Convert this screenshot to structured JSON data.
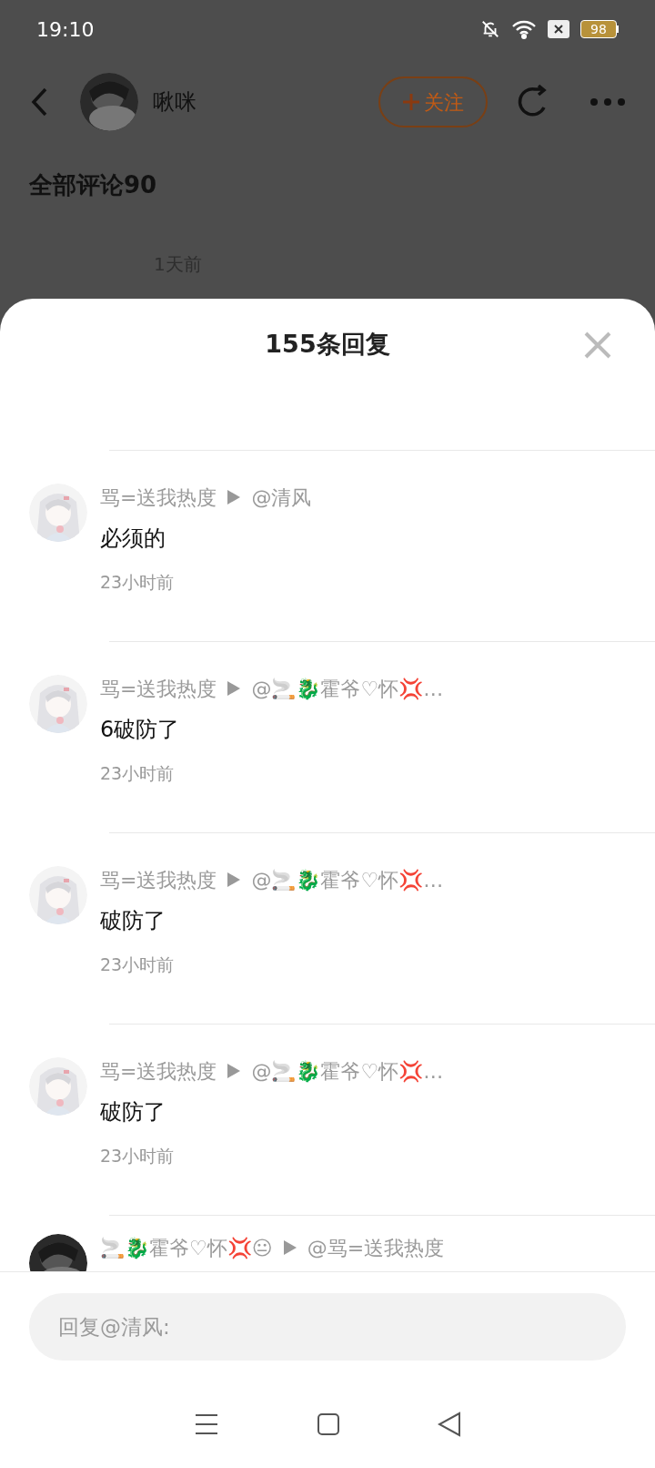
{
  "status_bar": {
    "time": "19:10",
    "battery": "98"
  },
  "header": {
    "username": "啾咪",
    "follow_button": "关注"
  },
  "background": {
    "section_title": "全部评论90",
    "comment_time": "1天前"
  },
  "replies_sheet": {
    "title": "155条回复",
    "replies": [
      {
        "author": "骂=送我热度",
        "reply_to": "@清风",
        "content": "必须的",
        "time": "23小时前"
      },
      {
        "author": "骂=送我热度",
        "reply_to": "@🚬🐉霍爷♡怀💢…",
        "content": "6破防了",
        "time": "23小时前"
      },
      {
        "author": "骂=送我热度",
        "reply_to": "@🚬🐉霍爷♡怀💢…",
        "content": "破防了",
        "time": "23小时前"
      },
      {
        "author": "骂=送我热度",
        "reply_to": "@🚬🐉霍爷♡怀💢…",
        "content": "破防了",
        "time": "23小时前"
      },
      {
        "author": "🚬🐉霍爷♡怀💢😐",
        "reply_to": "@骂=送我热度"
      }
    ]
  },
  "reply_input": {
    "placeholder": "回复@清风:"
  }
}
